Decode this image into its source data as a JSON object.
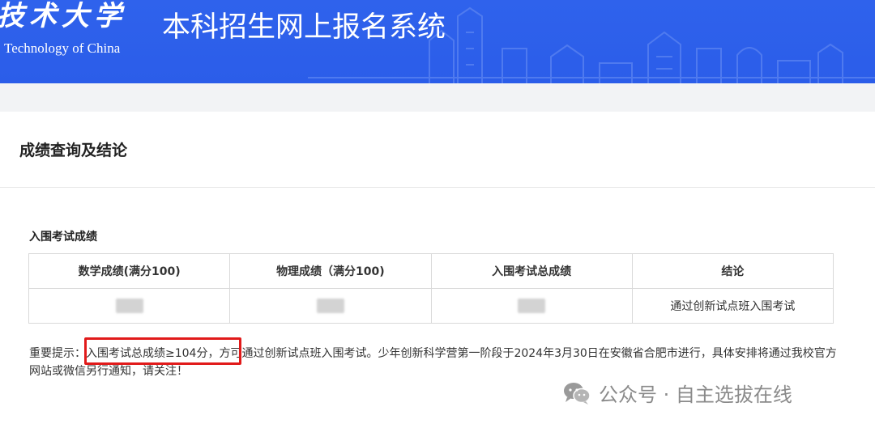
{
  "banner": {
    "university_cn": "技术大学",
    "university_en": "Technology of China",
    "system_title": "本科招生网上报名系统"
  },
  "panel": {
    "title": "成绩查询及结论",
    "section_label": "入围考试成绩",
    "table": {
      "headers": [
        "数学成绩(满分100)",
        "物理成绩（满分100)",
        "入围考试总成绩",
        "结论"
      ],
      "row": {
        "conclusion": "通过创新试点班入围考试"
      }
    },
    "notice": {
      "prefix": "重要提示：",
      "highlight": "入围考试总成绩≥104分，",
      "rest": "方可通过创新试点班入围考试。少年创新科学营第一阶段于2024年3月30日在安徽省合肥市进行，具体安排将通过我校官方网站或微信另行通知，请关注！"
    }
  },
  "watermark": {
    "text": "公众号 · 自主选拔在线"
  },
  "colors": {
    "banner_blue": "#2f62ec",
    "highlight_red": "#e11a1a"
  }
}
